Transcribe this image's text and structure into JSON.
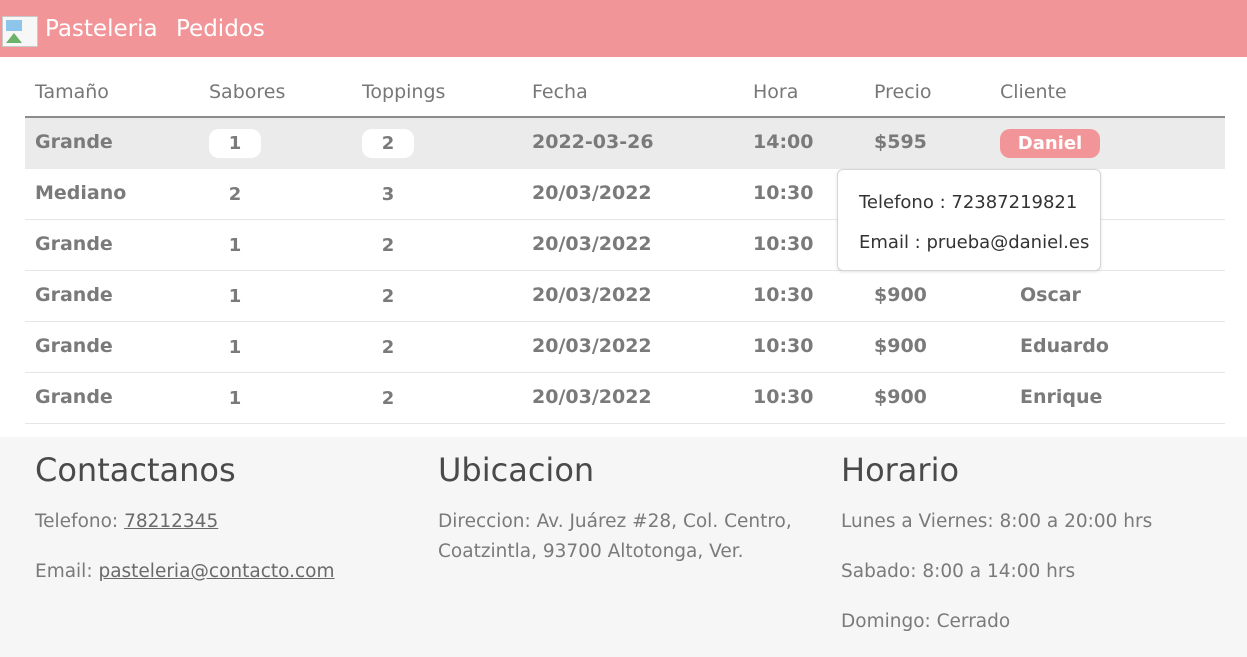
{
  "nav": {
    "logo_icon": "broken-image-icon",
    "brand": "Pasteleria",
    "pedidos": "Pedidos"
  },
  "table": {
    "headers": [
      "Tamaño",
      "Sabores",
      "Toppings",
      "Fecha",
      "Hora",
      "Precio",
      "Cliente"
    ],
    "rows": [
      {
        "tamano": "Grande",
        "sabores": "1",
        "toppings": "2",
        "fecha": "2022-03-26",
        "hora": "14:00",
        "precio": "$595",
        "cliente": "Daniel"
      },
      {
        "tamano": "Mediano",
        "sabores": "2",
        "toppings": "3",
        "fecha": "20/03/2022",
        "hora": "10:30",
        "precio": "",
        "cliente": ""
      },
      {
        "tamano": "Grande",
        "sabores": "1",
        "toppings": "2",
        "fecha": "20/03/2022",
        "hora": "10:30",
        "precio": "",
        "cliente": ""
      },
      {
        "tamano": "Grande",
        "sabores": "1",
        "toppings": "2",
        "fecha": "20/03/2022",
        "hora": "10:30",
        "precio": "$900",
        "cliente": "Oscar"
      },
      {
        "tamano": "Grande",
        "sabores": "1",
        "toppings": "2",
        "fecha": "20/03/2022",
        "hora": "10:30",
        "precio": "$900",
        "cliente": "Eduardo"
      },
      {
        "tamano": "Grande",
        "sabores": "1",
        "toppings": "2",
        "fecha": "20/03/2022",
        "hora": "10:30",
        "precio": "$900",
        "cliente": "Enrique"
      }
    ]
  },
  "popover": {
    "telefono": "Telefono : 72387219821",
    "email": "Email : prueba@daniel.es"
  },
  "footer": {
    "contacto": {
      "title": "Contactanos",
      "telefono_label": "Telefono: ",
      "telefono_link": "78212345",
      "email_label": "Email: ",
      "email_link": "pasteleria@contacto.com"
    },
    "ubicacion": {
      "title": "Ubicacion",
      "direccion_1": "Direccion: Av. Juárez #28, Col. Centro,",
      "direccion_2": "Coatzintla, 93700 Altotonga, Ver."
    },
    "horario": {
      "title": "Horario",
      "semana": "Lunes a Viernes: 8:00 a 20:00 hrs",
      "sabado": "Sabado: 8:00 a 14:00 hrs",
      "domingo": "Domingo: Cerrado"
    }
  },
  "colors": {
    "accent": "#f29598",
    "footer_bg": "#f6f6f6"
  }
}
